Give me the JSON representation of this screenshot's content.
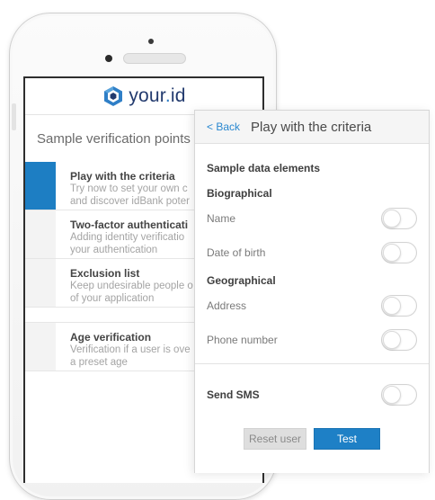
{
  "phone_app": {
    "brand": {
      "name": "your",
      "dot": ".",
      "suffix": "id"
    },
    "screen_title": "Sample verification points",
    "items": [
      {
        "title": "Play with the criteria",
        "desc_line1": "Try now to set your own c",
        "desc_line2": "and discover idBank poter",
        "active": true
      },
      {
        "title": "Two-factor authenticati",
        "desc_line1": "Adding identity verificatio",
        "desc_line2": "your authentication",
        "active": false
      },
      {
        "title": "Exclusion list",
        "desc_line1": "Keep undesirable people o",
        "desc_line2": "of your application",
        "active": false
      },
      {
        "title": "Age verification",
        "desc_line1": "Verification if a user is ove",
        "desc_line2": "a preset age",
        "active": false
      }
    ]
  },
  "panel": {
    "back_label": "< Back",
    "title": "Play with the criteria",
    "sample_heading": "Sample data elements",
    "biographical": {
      "heading": "Biographical",
      "fields": [
        {
          "label": "Name",
          "enabled": false
        },
        {
          "label": "Date of birth",
          "enabled": false
        }
      ]
    },
    "geographical": {
      "heading": "Geographical",
      "fields": [
        {
          "label": "Address",
          "enabled": false
        },
        {
          "label": "Phone number",
          "enabled": false
        }
      ]
    },
    "send_sms": {
      "label": "Send SMS",
      "enabled": false
    },
    "reset_label": "Reset user",
    "test_label": "Test"
  },
  "colors": {
    "accent": "#1d7ec3",
    "brand_dark": "#223a6e",
    "link": "#2a88d0"
  },
  "icons": {
    "logo": "your-id-hexagon-logo-icon"
  }
}
